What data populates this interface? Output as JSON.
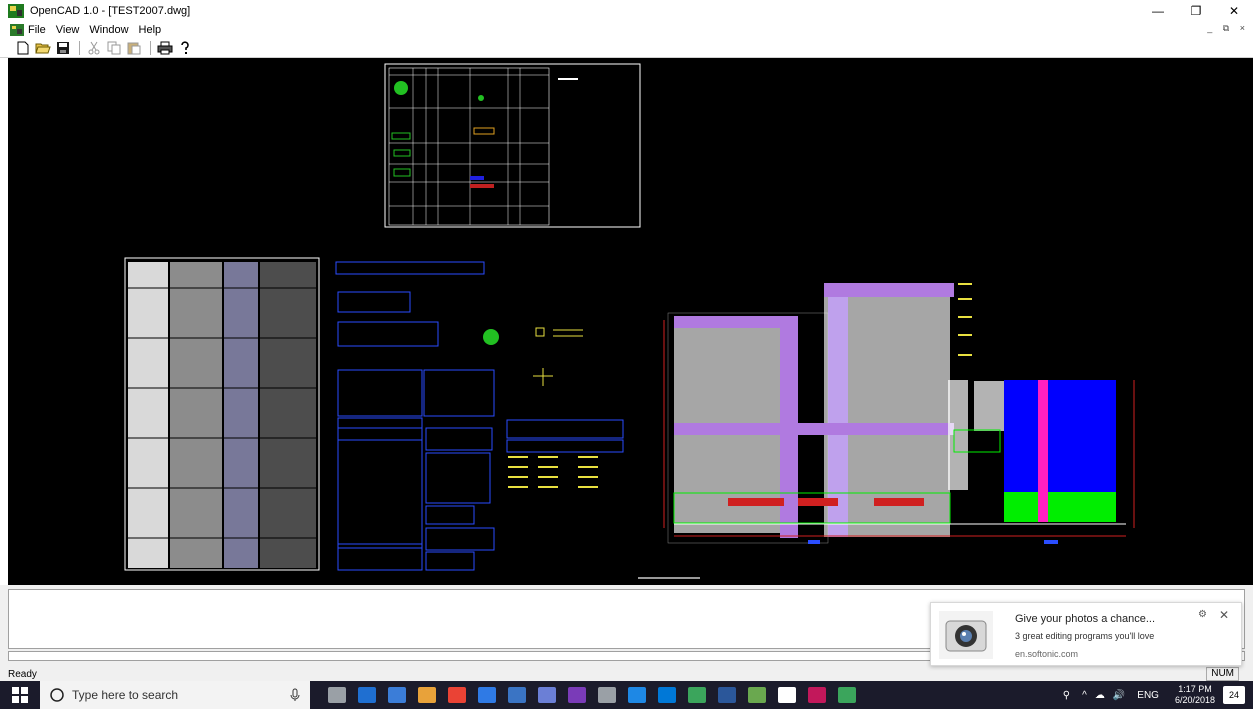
{
  "window": {
    "title": "OpenCAD 1.0 - [TEST2007.dwg]",
    "minimize_glyph": "—",
    "restore_glyph": "❐",
    "close_glyph": "✕"
  },
  "menu": {
    "items": [
      "File",
      "View",
      "Window",
      "Help"
    ],
    "mdi_controls": "_ ⧉ ×"
  },
  "toolbar": {
    "buttons": [
      "new-icon",
      "open-icon",
      "save-icon",
      "cut-icon",
      "copy-icon",
      "paste-icon",
      "print-icon",
      "help-icon"
    ]
  },
  "drawing": {
    "filename": "TEST2007.dwg",
    "background": "#000000"
  },
  "statusbar": {
    "status": "Ready",
    "num": "NUM"
  },
  "toast": {
    "title": "Give your photos a chance...",
    "body": "3 great editing programs you'll love",
    "source": "en.softonic.com"
  },
  "taskbar": {
    "search_placeholder": "Type here to search",
    "time": "1:17 PM",
    "date": "6/20/2018",
    "language": "ENG",
    "notification_count": "24",
    "app_colors": [
      "#9aa0a6",
      "#1f6fd1",
      "#3b7dd8",
      "#e8a23a",
      "#ea4335",
      "#2f7ae5",
      "#3a74c4",
      "#6b7fd6",
      "#7a3bb8",
      "#9aa0a6",
      "#1e88e5",
      "#0078d7",
      "#3ba55c",
      "#2b579a",
      "#6aa84f",
      "#ffffff",
      "#c2185b",
      "#3ba55c"
    ]
  }
}
